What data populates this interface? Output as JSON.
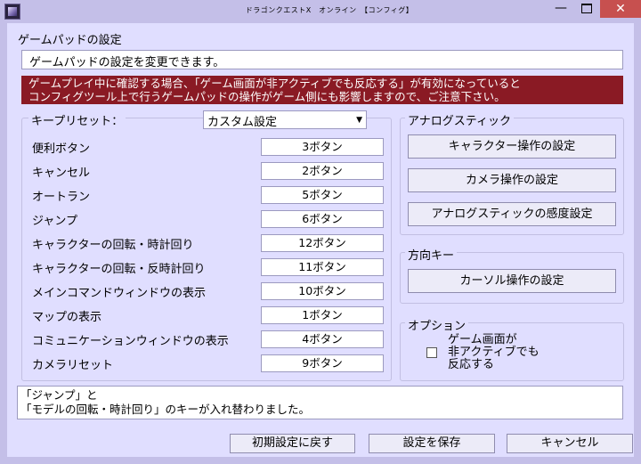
{
  "window": {
    "title": "ドラゴンクエストX　オンライン　【コンフィグ】",
    "minimize_glyph": "—",
    "close_glyph": "✕"
  },
  "header": {
    "section_title": "ゲームパッドの設定",
    "description": "ゲームパッドの設定を変更できます。",
    "warning_line1": "ゲームプレイ中に確認する場合、「ゲーム画面が非アクティブでも反応する」が有効になっていると",
    "warning_line2": "コンフィグツール上で行うゲームパッドの操作がゲーム側にも影響しますので、ご注意下さい。"
  },
  "keys": {
    "preset_label": "キープリセット：",
    "preset_value": "カスタム設定",
    "rows": [
      {
        "label": "便利ボタン",
        "value": "3ボタン"
      },
      {
        "label": "キャンセル",
        "value": "2ボタン"
      },
      {
        "label": "オートラン",
        "value": "5ボタン"
      },
      {
        "label": "ジャンプ",
        "value": "6ボタン"
      },
      {
        "label": "キャラクターの回転・時計回り",
        "value": "12ボタン"
      },
      {
        "label": "キャラクターの回転・反時計回り",
        "value": "11ボタン"
      },
      {
        "label": "メインコマンドウィンドウの表示",
        "value": "10ボタン"
      },
      {
        "label": "マップの表示",
        "value": "1ボタン"
      },
      {
        "label": "コミュニケーションウィンドウの表示",
        "value": "4ボタン"
      },
      {
        "label": "カメラリセット",
        "value": "9ボタン"
      }
    ]
  },
  "analog": {
    "title": "アナログスティック",
    "char_btn": "キャラクター操作の設定",
    "camera_btn": "カメラ操作の設定",
    "sens_btn": "アナログスティックの感度設定"
  },
  "direction": {
    "title": "方向キー",
    "cursor_btn": "カーソル操作の設定"
  },
  "option": {
    "title": "オプション",
    "bg_line1": "ゲーム画面が",
    "bg_line2": "非アクティブでも",
    "bg_line3": "反応する"
  },
  "log": {
    "line1": "「ジャンプ」と",
    "line2": "「モデルの回転・時計回り」のキーが入れ替わりました。"
  },
  "footer": {
    "reset_btn": "初期設定に戻す",
    "save_btn": "設定を保存",
    "cancel_btn": "キャンセル"
  }
}
